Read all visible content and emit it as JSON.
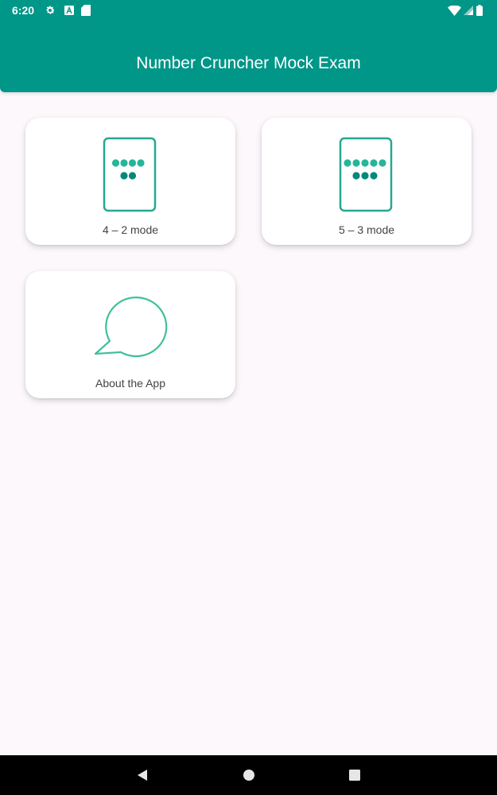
{
  "status_bar": {
    "time": "6:20",
    "icons_left": [
      "settings-icon",
      "a-letter-icon",
      "sd-card-icon"
    ],
    "icons_right": [
      "wifi-icon",
      "signal-icon",
      "battery-icon"
    ]
  },
  "app_bar": {
    "title": "Number Cruncher Mock Exam",
    "color": "#009688"
  },
  "cards": [
    {
      "label": "4 – 2 mode",
      "icon": "tablet-dots-4-2-icon",
      "top_dots": 4,
      "bottom_dots": 2
    },
    {
      "label": "5 – 3 mode",
      "icon": "tablet-dots-5-3-icon",
      "top_dots": 5,
      "bottom_dots": 3
    },
    {
      "label": "About the App",
      "icon": "speech-bubble-icon"
    }
  ],
  "colors": {
    "accent": "#009688",
    "dot_light": "#26b59a",
    "dot_dark": "#00897b",
    "bubble": "#3ec09d",
    "background": "#fcf8fc"
  },
  "nav_bar": {
    "buttons": [
      "back-icon",
      "home-icon",
      "recents-icon"
    ]
  }
}
